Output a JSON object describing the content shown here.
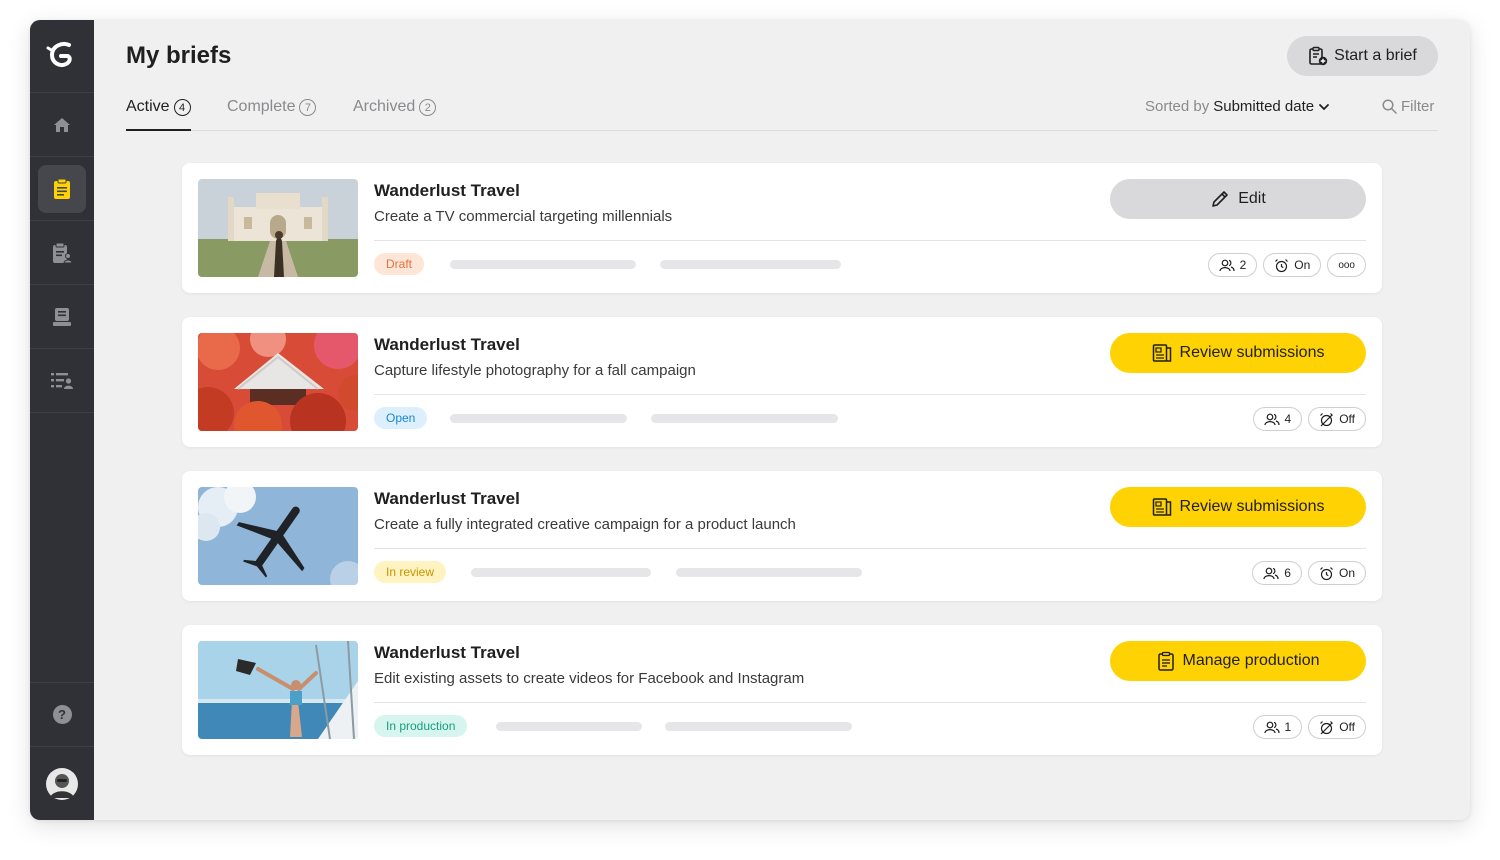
{
  "page": {
    "title": "My briefs",
    "start_button": "Start a brief"
  },
  "tabs": [
    {
      "label": "Active",
      "count": "4"
    },
    {
      "label": "Complete",
      "count": "7"
    },
    {
      "label": "Archived",
      "count": "2"
    }
  ],
  "sort": {
    "prefix": "Sorted by",
    "value": "Submitted date"
  },
  "filter_label": "Filter",
  "sidebar": {
    "logo": "G",
    "items": [
      {
        "icon": "home-icon"
      },
      {
        "icon": "clipboard-icon",
        "active": true
      },
      {
        "icon": "clipboard-user-icon"
      },
      {
        "icon": "inbox-icon"
      },
      {
        "icon": "list-user-icon"
      }
    ],
    "help": "?"
  },
  "briefs": [
    {
      "brand": "Wanderlust Travel",
      "description": "Create a TV commercial targeting millennials",
      "status": "Draft",
      "action": "Edit",
      "collaborators": "2",
      "alarm": "On",
      "more": "ooo"
    },
    {
      "brand": "Wanderlust Travel",
      "description": "Capture lifestyle photography for a fall campaign",
      "status": "Open",
      "action": "Review submissions",
      "collaborators": "4",
      "alarm": "Off"
    },
    {
      "brand": "Wanderlust Travel",
      "description": "Create a fully integrated creative campaign for a product launch",
      "status": "In review",
      "action": "Review submissions",
      "collaborators": "6",
      "alarm": "On"
    },
    {
      "brand": "Wanderlust Travel",
      "description": "Edit existing assets to create videos for Facebook and Instagram",
      "status": "In production",
      "action": "Manage production",
      "collaborators": "1",
      "alarm": "Off"
    }
  ],
  "colors": {
    "sidebar": "#2f3136",
    "accent_yellow": "#ffd204",
    "draft_bg": "#fde5d8",
    "draft_fg": "#e2743f",
    "open_bg": "#dbeffd",
    "open_fg": "#1a86d0",
    "review_bg": "#fff3c2",
    "review_fg": "#c89400",
    "production_bg": "#d6f5ee",
    "production_fg": "#1a9c80"
  }
}
